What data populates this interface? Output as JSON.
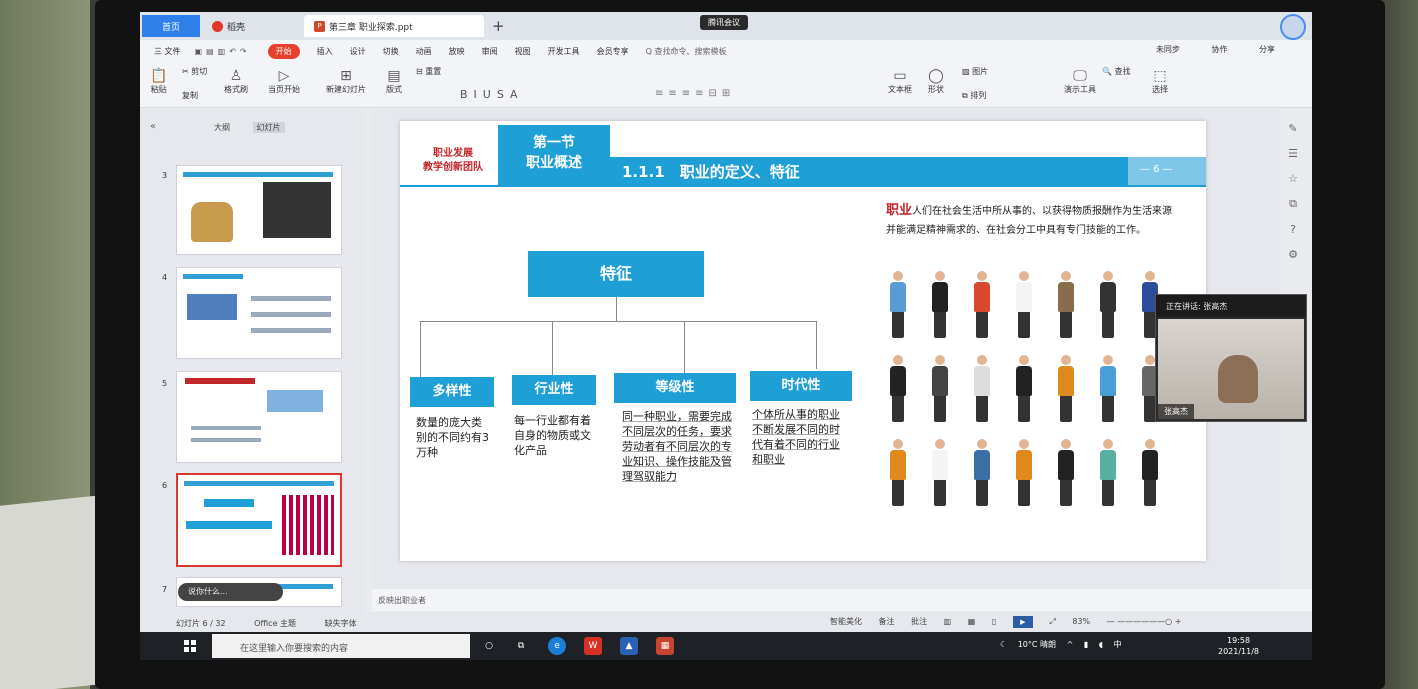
{
  "window": {
    "tabs": [
      {
        "label": "首页"
      },
      {
        "label": "稻壳"
      },
      {
        "label": "第三章 职业探索.ppt"
      }
    ],
    "meeting_label": "腾讯会议"
  },
  "menu": {
    "file": "三 文件",
    "items": [
      "开始",
      "插入",
      "设计",
      "切换",
      "动画",
      "放映",
      "审阅",
      "视图",
      "开发工具",
      "会员专享"
    ],
    "search": "Q 查找命令、搜索模板",
    "right": [
      "未同步",
      "协作",
      "分享"
    ]
  },
  "ribbon": {
    "buttons": [
      {
        "label": "粘贴",
        "icon": "paste-icon"
      },
      {
        "label": "剪切",
        "icon": "cut-icon"
      },
      {
        "label": "格式刷",
        "icon": "format-painter-icon"
      },
      {
        "label": "当页开始",
        "icon": "play-icon"
      },
      {
        "label": "新建幻灯片",
        "icon": "new-slide-icon"
      },
      {
        "label": "版式",
        "icon": "layout-icon"
      },
      {
        "label": "重置",
        "icon": "reset-icon"
      },
      {
        "label": "文本框",
        "icon": "textbox-icon"
      },
      {
        "label": "形状",
        "icon": "shape-icon"
      },
      {
        "label": "图片",
        "icon": "picture-icon"
      },
      {
        "label": "排列",
        "icon": "arrange-icon"
      },
      {
        "label": "演示工具",
        "icon": "presentation-tools-icon"
      },
      {
        "label": "查找",
        "icon": "find-icon"
      },
      {
        "label": "选择",
        "icon": "select-icon"
      }
    ],
    "copy": "复制"
  },
  "left_panel": {
    "tabs": [
      "大纲",
      "幻灯片"
    ],
    "thumb_numbers": [
      "3",
      "4",
      "5",
      "6",
      "7"
    ],
    "float_label": "说你什么..."
  },
  "slide": {
    "team": [
      "职业发展",
      "教学创新团队"
    ],
    "section": [
      "第一节",
      "职业概述"
    ],
    "title": "1.1.1　职业的定义、特征",
    "page_tag": "— 6 —",
    "main_feature": "特征",
    "features": [
      {
        "name": "多样性",
        "desc": "数量的庞大类别的不同约有3万种"
      },
      {
        "name": "行业性",
        "desc": "每一行业都有着自身的物质或文化产品"
      },
      {
        "name": "等级性",
        "desc": "同一种职业，需要完成不同层次的任务，要求劳动者有不同层次的专业知识、操作技能及管理驾驭能力"
      },
      {
        "name": "时代性",
        "desc": "个体所从事的职业不断发展不同的时代有着不同的行业和职业"
      }
    ],
    "definition_keyword": "职业",
    "definition": "人们在社会生活中所从事的、以获得物质报酬作为生活来源并能满足精神需求的、在社会分工中具有专门技能的工作。"
  },
  "camera": {
    "caption": "正在讲话: 张高杰",
    "name": "张高杰"
  },
  "notes": "反映出职业者",
  "status": {
    "slide_count": "幻灯片 6 / 32",
    "theme": "Office 主题",
    "missing_font": "缺失字体",
    "smart": "智能美化",
    "notes_btn": "备注",
    "comment_btn": "批注",
    "zoom": "83%"
  },
  "taskbar": {
    "search_placeholder": "在这里输入你要搜索的内容",
    "weather": "10°C 晴朗",
    "ime": "中",
    "time": "19:58",
    "date": "2021/11/8"
  },
  "colors": {
    "accent_blue": "#1e9fd6",
    "title_red": "#c0262a",
    "start_red": "#e8402e"
  }
}
